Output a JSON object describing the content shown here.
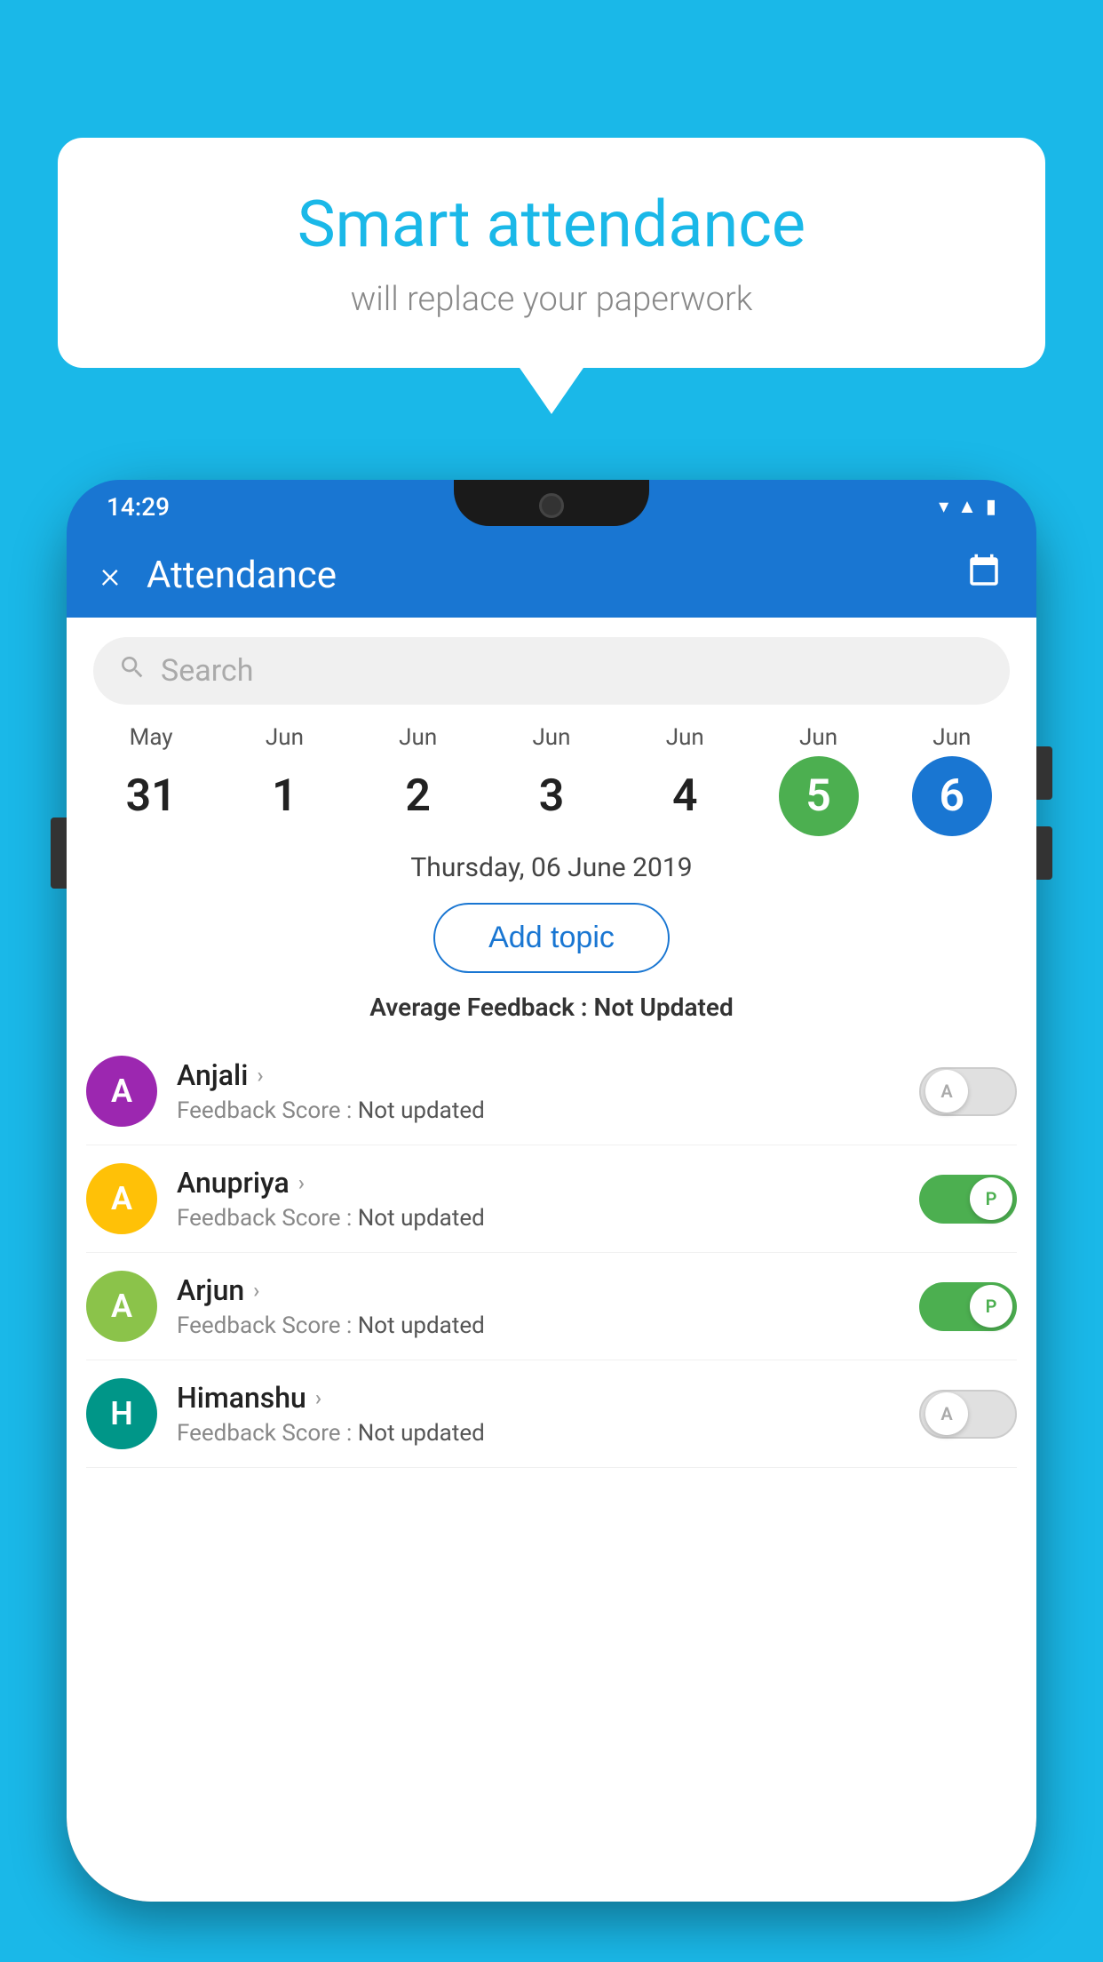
{
  "background": {
    "color": "#1ab8e8"
  },
  "bubble": {
    "title": "Smart attendance",
    "subtitle": "will replace your paperwork"
  },
  "status_bar": {
    "time": "14:29",
    "icons": [
      "▲",
      "▲",
      "▮"
    ]
  },
  "header": {
    "title": "Attendance",
    "close_label": "×",
    "calendar_icon": "📅"
  },
  "search": {
    "placeholder": "Search"
  },
  "dates": [
    {
      "month": "May",
      "day": "31",
      "state": "normal"
    },
    {
      "month": "Jun",
      "day": "1",
      "state": "normal"
    },
    {
      "month": "Jun",
      "day": "2",
      "state": "normal"
    },
    {
      "month": "Jun",
      "day": "3",
      "state": "normal"
    },
    {
      "month": "Jun",
      "day": "4",
      "state": "normal"
    },
    {
      "month": "Jun",
      "day": "5",
      "state": "today"
    },
    {
      "month": "Jun",
      "day": "6",
      "state": "selected"
    }
  ],
  "selected_date_label": "Thursday, 06 June 2019",
  "add_topic_label": "Add topic",
  "avg_feedback_label": "Average Feedback : ",
  "avg_feedback_value": "Not Updated",
  "students": [
    {
      "name": "Anjali",
      "avatar_letter": "A",
      "avatar_color": "purple",
      "feedback_label": "Feedback Score : ",
      "feedback_value": "Not updated",
      "toggle_state": "off",
      "toggle_letter": "A"
    },
    {
      "name": "Anupriya",
      "avatar_letter": "A",
      "avatar_color": "yellow",
      "feedback_label": "Feedback Score : ",
      "feedback_value": "Not updated",
      "toggle_state": "on",
      "toggle_letter": "P"
    },
    {
      "name": "Arjun",
      "avatar_letter": "A",
      "avatar_color": "green-light",
      "feedback_label": "Feedback Score : ",
      "feedback_value": "Not updated",
      "toggle_state": "on",
      "toggle_letter": "P"
    },
    {
      "name": "Himanshu",
      "avatar_letter": "H",
      "avatar_color": "teal",
      "feedback_label": "Feedback Score : ",
      "feedback_value": "Not updated",
      "toggle_state": "off",
      "toggle_letter": "A"
    }
  ]
}
